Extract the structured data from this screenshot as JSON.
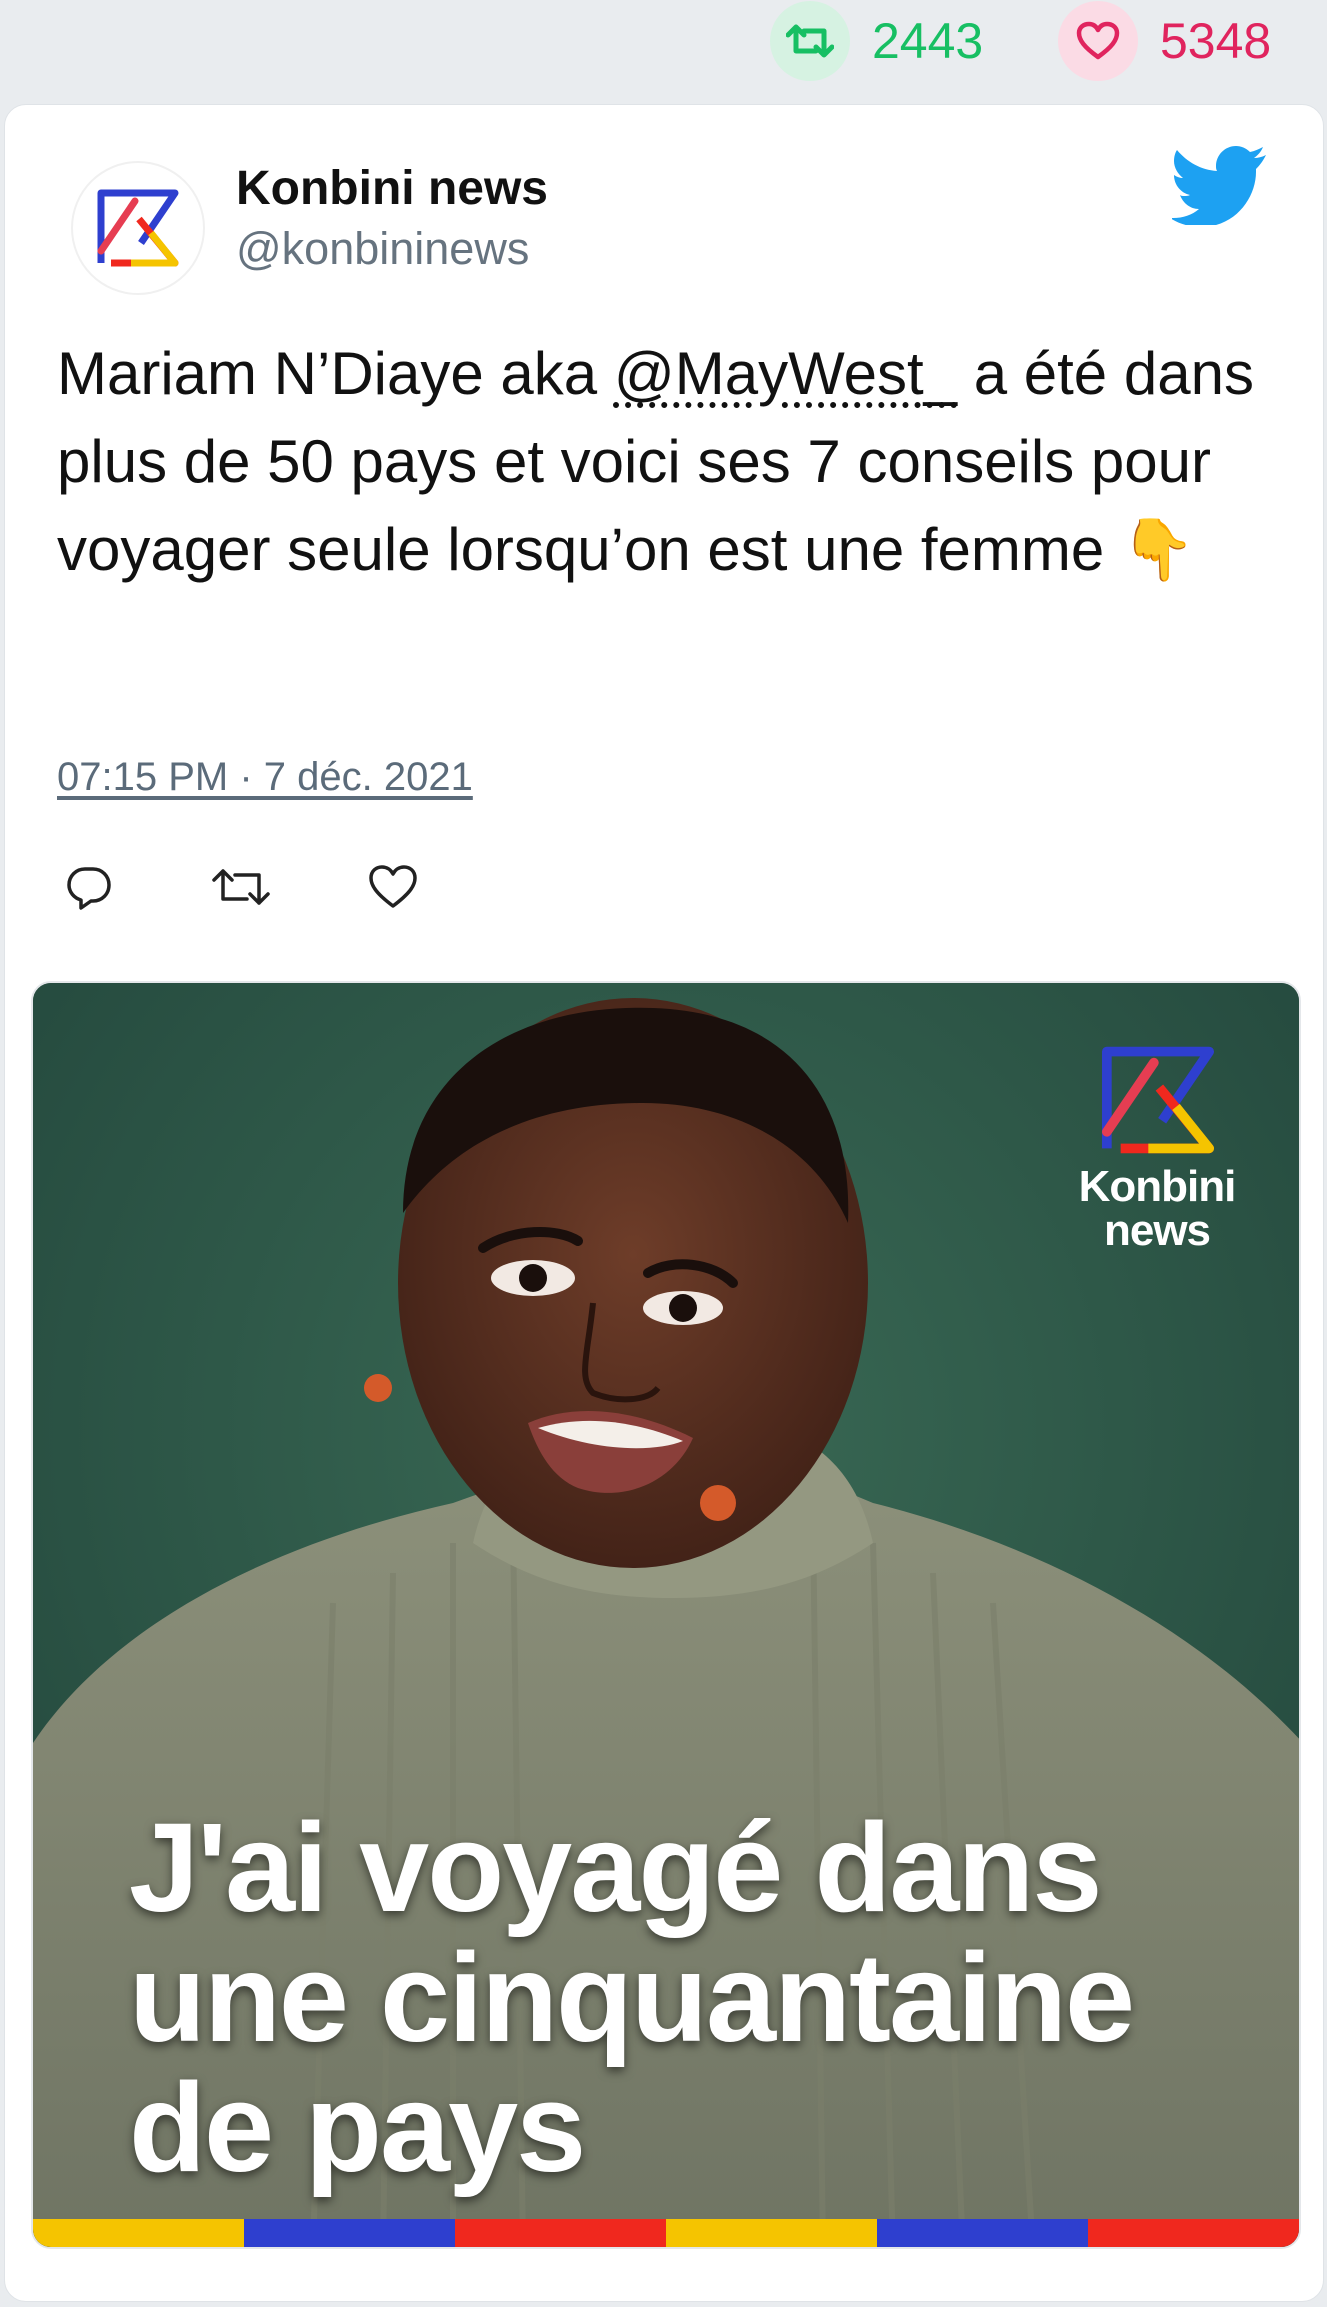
{
  "stats": {
    "retweets": "2443",
    "likes": "5348"
  },
  "tweet": {
    "author_name": "Konbini news",
    "author_handle": "@konbininews",
    "text_before": "Mariam N’Diaye aka ",
    "mention": "@MayWest_",
    "text_after": " a été dans plus de 50 pays et voici ses 7 conseils pour voyager seule lorsqu’on est une femme ",
    "emoji": "👇",
    "timestamp": "07:15 PM · 7 déc. 2021"
  },
  "media": {
    "overlay_lines": [
      "J'ai voyagé dans",
      "une cinquantaine",
      "de pays"
    ],
    "brand_line1": "Konbini",
    "brand_line2": "news",
    "stripe_colors": [
      "#f5c400",
      "#2e3fcf",
      "#f0281e",
      "#f5c400",
      "#2e3fcf",
      "#f0281e"
    ]
  },
  "colors": {
    "retweet": "#17bf63",
    "like": "#e0245e",
    "twitter_blue": "#1da1f2",
    "media_background": "#2e5544"
  },
  "icons": {
    "retweet": "retweet-icon",
    "like": "heart-icon",
    "reply": "reply-icon",
    "twitter": "twitter-bird-icon"
  }
}
